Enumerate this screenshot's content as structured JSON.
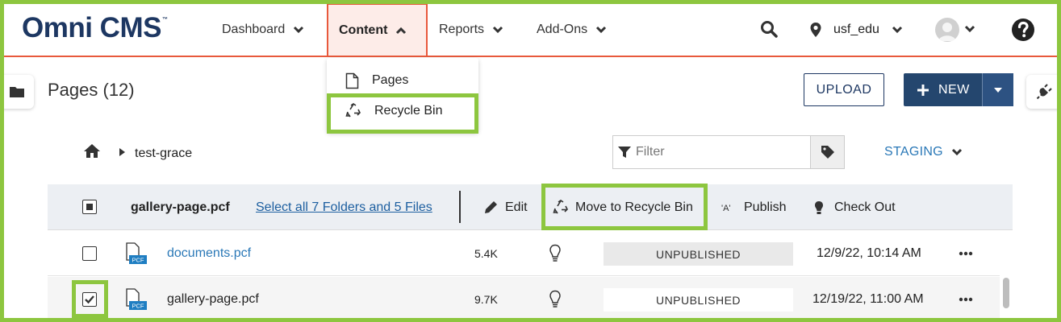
{
  "app": {
    "logo": "Omni CMS",
    "logo_tm": "™"
  },
  "nav": {
    "dashboard": "Dashboard",
    "content": "Content",
    "reports": "Reports",
    "addons": "Add-Ons",
    "site": "usf_edu"
  },
  "content_menu": {
    "pages": "Pages",
    "recycle_bin": "Recycle Bin"
  },
  "page": {
    "title": "Pages (12)",
    "upload": "UPLOAD",
    "new": "NEW"
  },
  "breadcrumb": {
    "folder": "test-grace"
  },
  "filter": {
    "placeholder": "Filter"
  },
  "environment": "STAGING",
  "actions": {
    "selected_file": "gallery-page.pcf",
    "select_all": "Select all 7 Folders and 5 Files",
    "edit": "Edit",
    "move_to_recycle": "Move to Recycle Bin",
    "publish": "Publish",
    "check_out": "Check Out"
  },
  "files": [
    {
      "name": "documents.pcf",
      "size": "5.4K",
      "status": "UNPUBLISHED",
      "modified": "12/9/22, 10:14 AM",
      "checked": false
    },
    {
      "name": "gallery-page.pcf",
      "size": "9.7K",
      "status": "UNPUBLISHED",
      "modified": "12/19/22, 11:00 AM",
      "checked": true
    }
  ],
  "file_icon_label": "PCF",
  "colors": {
    "highlight": "#8dc63f",
    "brand": "#1d3762",
    "accent": "#e8593c",
    "link": "#2a78b7"
  }
}
